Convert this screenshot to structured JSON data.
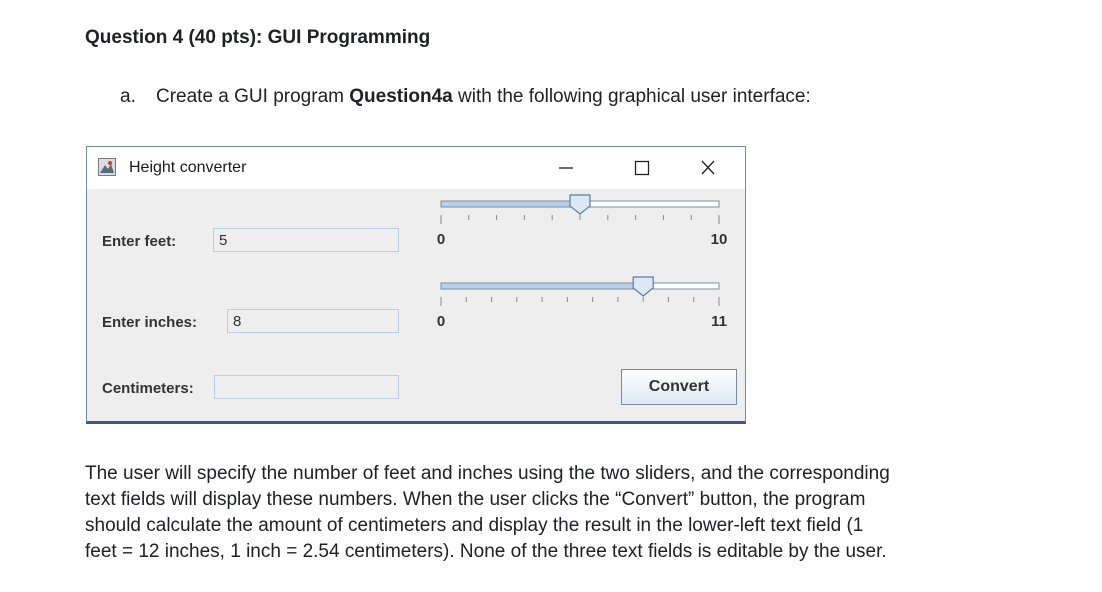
{
  "question": {
    "heading": "Question 4 (40 pts): GUI Programming",
    "item_marker": "a.",
    "item_text_before": "Create a GUI program ",
    "item_bold": "Question4a",
    "item_text_after": " with the following graphical user interface:"
  },
  "window": {
    "title": "Height converter",
    "feet_label": "Enter feet:",
    "feet_value": "5",
    "inches_label": "Enter inches:",
    "inches_value": "8",
    "cm_label": "Centimeters:",
    "cm_value": "",
    "convert_label": "Convert",
    "feet_slider": {
      "min": 0,
      "max": 10,
      "value": 5,
      "min_label": "0",
      "max_label": "10"
    },
    "inches_slider": {
      "min": 0,
      "max": 11,
      "value": 8,
      "min_label": "0",
      "max_label": "11"
    }
  },
  "paragraph": [
    "The user will specify the number of feet and inches using the two sliders, and the corresponding",
    "text fields will display these numbers. When the user clicks the “Convert” button, the program",
    "should calculate the amount of centimeters and display the result in the lower-left text field (1",
    "feet = 12 inches, 1 inch = 2.54 centimeters). None of the three text fields is editable by the user."
  ]
}
